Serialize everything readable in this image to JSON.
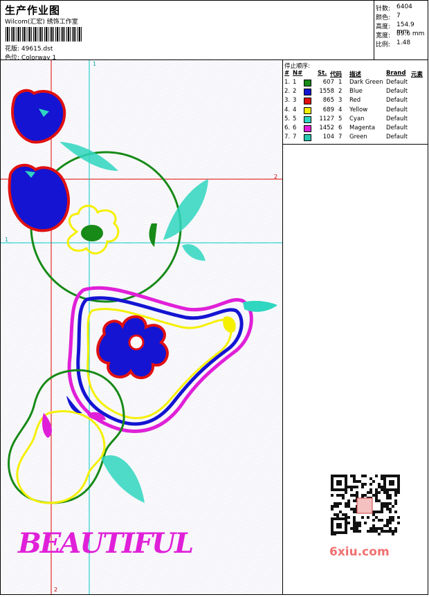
{
  "header": {
    "title": "生产作业图",
    "company": "Wilcom(汇宏) 绣饰工作室",
    "design_label": "花版:",
    "design_value": "49615.dst",
    "colorway_label": "色位:",
    "colorway_value": "Colorway 1"
  },
  "stats": [
    {
      "label": "针数:",
      "value": "6404"
    },
    {
      "label": "颜色:",
      "value": "7"
    },
    {
      "label": "高度:",
      "value": "154.9 mm"
    },
    {
      "label": "宽度:",
      "value": "89.6 mm"
    },
    {
      "label": "比例:",
      "value": "1.48"
    }
  ],
  "stop_table": {
    "caption": "停止顺序:",
    "columns": [
      "#",
      "N#",
      "St.",
      "代码",
      "描述",
      "Brand",
      "元素"
    ],
    "rows": [
      {
        "idx": "1.",
        "n": "1",
        "st": "607",
        "code": "1",
        "desc": "Dark Green",
        "brand": "Default",
        "color": "#178a17"
      },
      {
        "idx": "2.",
        "n": "2",
        "st": "1558",
        "code": "2",
        "desc": "Blue",
        "brand": "Default",
        "color": "#1414d2"
      },
      {
        "idx": "3.",
        "n": "3",
        "st": "865",
        "code": "3",
        "desc": "Red",
        "brand": "Default",
        "color": "#e01010"
      },
      {
        "idx": "4.",
        "n": "4",
        "st": "689",
        "code": "4",
        "desc": "Yellow",
        "brand": "Default",
        "color": "#f5f000"
      },
      {
        "idx": "5.",
        "n": "5",
        "st": "1127",
        "code": "5",
        "desc": "Cyan",
        "brand": "Default",
        "color": "#2fd6c0"
      },
      {
        "idx": "6.",
        "n": "6",
        "st": "1452",
        "code": "6",
        "desc": "Magenta",
        "brand": "Default",
        "color": "#e020d8"
      },
      {
        "idx": "7.",
        "n": "7",
        "st": "104",
        "code": "7",
        "desc": "Green",
        "brand": "Default",
        "color": "#28c8b0"
      }
    ]
  },
  "canvas": {
    "guide_1": "1",
    "guide_2": "2",
    "design_text": "BEAUTIFUL"
  },
  "watermark": "6xiu.com",
  "colors": {
    "guide_red": "#e00000",
    "guide_cyan": "#00c8c8"
  }
}
